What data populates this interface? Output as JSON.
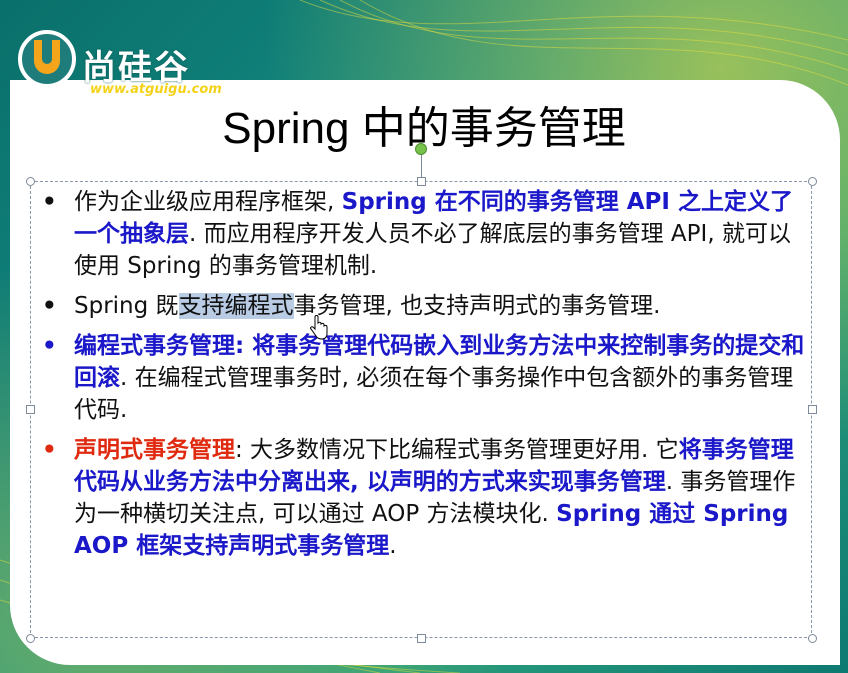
{
  "logo": {
    "name": "尚硅谷",
    "url": "www.atguigu.com"
  },
  "slide": {
    "title": "Spring 中的事务管理",
    "bullets": [
      {
        "color": "black",
        "segments": [
          {
            "style": "n",
            "text": "作为企业级应用程序框架, "
          },
          {
            "style": "b",
            "text": "Spring 在不同的事务管理 API 之上定义了一个抽象层"
          },
          {
            "style": "n",
            "text": ". 而应用程序开发人员不必了解底层的事务管理 API, 就可以使用 Spring 的事务管理机制."
          }
        ]
      },
      {
        "color": "black",
        "segments": [
          {
            "style": "n",
            "text": "Spring 既"
          },
          {
            "style": "sel",
            "text": "支持编程式"
          },
          {
            "style": "n",
            "text": "事务管理, 也支持声明式的事务管理."
          }
        ]
      },
      {
        "color": "blue",
        "segments": [
          {
            "style": "b",
            "text": "编程式事务管理: 将事务管理代码嵌入到业务方法中来控制事务的提交和回滚"
          },
          {
            "style": "n",
            "text": ". 在编程式管理事务时, 必须在每个事务操作中包含额外的事务管理代码."
          }
        ]
      },
      {
        "color": "red",
        "segments": [
          {
            "style": "r",
            "text": "声明式事务管理"
          },
          {
            "style": "n",
            "text": ": 大多数情况下比编程式事务管理更好用. 它"
          },
          {
            "style": "b",
            "text": "将事务管理代码从业务方法中分离出来, 以声明的方式来实现事务管理"
          },
          {
            "style": "n",
            "text": ". 事务管理作为一种横切关注点, 可以通过 AOP 方法模块化. "
          },
          {
            "style": "b",
            "text": "Spring 通过 Spring AOP 框架支持声明式事务管理"
          },
          {
            "style": "n",
            "text": "."
          }
        ]
      }
    ]
  },
  "colors": {
    "blue_emphasis": "#1a18c8",
    "red_emphasis": "#e02a10",
    "teal_background": "#0f7d78",
    "selection": "#b9cce4"
  }
}
